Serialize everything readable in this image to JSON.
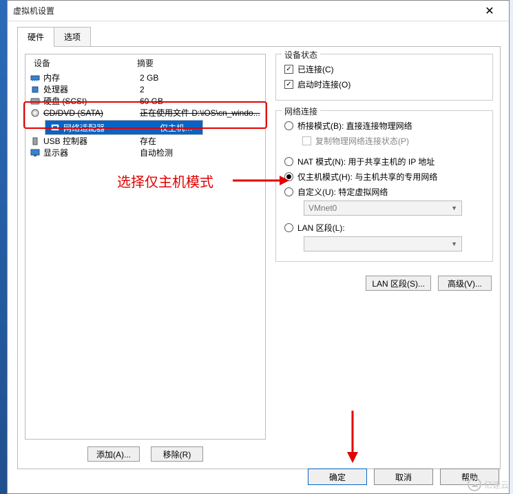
{
  "window": {
    "title": "虚拟机设置",
    "close_glyph": "✕"
  },
  "tabs": {
    "hardware": "硬件",
    "options": "选项"
  },
  "hwcols": {
    "device": "设备",
    "summary": "摘要"
  },
  "hw": [
    {
      "icon": "memory-icon",
      "name": "内存",
      "summary": "2 GB"
    },
    {
      "icon": "cpu-icon",
      "name": "处理器",
      "summary": "2"
    },
    {
      "icon": "disk-icon",
      "name": "硬盘 (SCSI)",
      "summary": "60 GB"
    },
    {
      "icon": "cd-icon",
      "name": "CD/DVD (SATA)",
      "summary": "正在使用文件 D:\\iOS\\cn_windo...",
      "strike": true
    },
    {
      "icon": "nic-icon",
      "name": "网络适配器",
      "summary": "仅主机模式",
      "selected": true
    },
    {
      "icon": "usb-icon",
      "name": "USB 控制器",
      "summary": "存在"
    },
    {
      "icon": "display-icon",
      "name": "显示器",
      "summary": "自动检测"
    }
  ],
  "left_buttons": {
    "add": "添加(A)...",
    "remove": "移除(R)"
  },
  "status": {
    "legend": "设备状态",
    "connected": "已连接(C)",
    "connect_on": "启动时连接(O)"
  },
  "net": {
    "legend": "网络连接",
    "bridge": "桥接模式(B): 直接连接物理网络",
    "repl": "复制物理网络连接状态(P)",
    "nat": "NAT 模式(N): 用于共享主机的 IP 地址",
    "hostonly": "仅主机模式(H): 与主机共享的专用网络",
    "custom": "自定义(U): 特定虚拟网络",
    "vmnet": "VMnet0",
    "lanseg": "LAN 区段(L):",
    "lanseg_btn": "LAN 区段(S)...",
    "adv_btn": "高级(V)..."
  },
  "footer": {
    "ok": "确定",
    "cancel": "取消",
    "help": "帮助"
  },
  "annotation": "选择仅主机模式",
  "watermark": "亿速云"
}
